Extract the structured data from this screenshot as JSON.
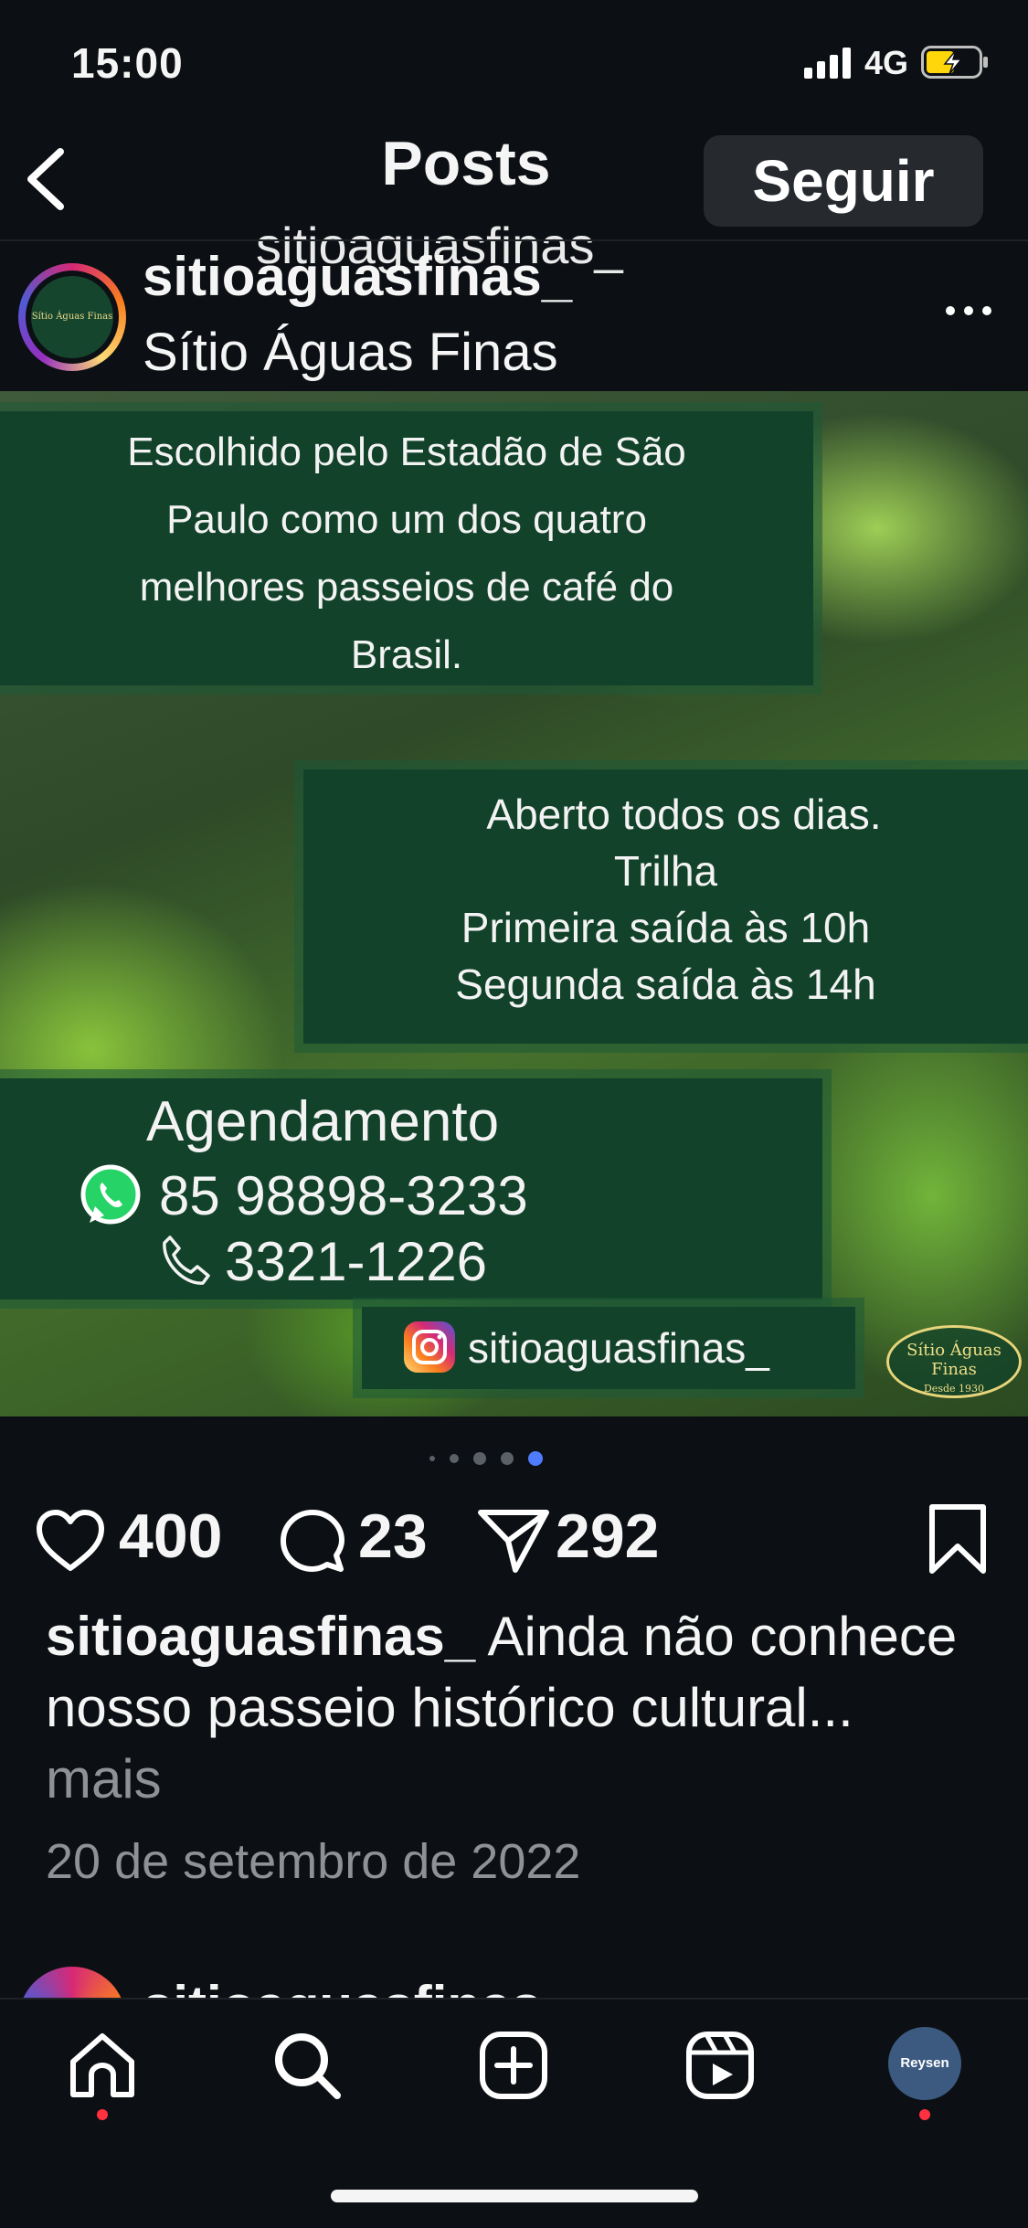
{
  "status_bar": {
    "time": "15:00",
    "network": "4G"
  },
  "header": {
    "title": "Posts",
    "subtitle": "sitioaguasfinas_",
    "follow_label": "Seguir"
  },
  "post": {
    "username": "sitioaguasfinas_",
    "location": "Sítio Águas Finas",
    "image": {
      "box1": [
        "Escolhido pelo Estadão de São",
        "Paulo como um dos quatro",
        "melhores passeios de café do",
        "Brasil."
      ],
      "box2": [
        "Aberto todos os dias.",
        "Trilha",
        "Primeira saída às 10h",
        "Segunda saída às 14h"
      ],
      "agenda_title": "Agendamento",
      "whatsapp": "85 98898-3233",
      "phone": "3321-1226",
      "instagram": "sitioaguasfinas_",
      "logo_name": "Sítio Águas Finas",
      "logo_since": "Desde 1930"
    },
    "carousel": {
      "count": 5,
      "active": 5
    },
    "likes": "400",
    "comments": "23",
    "shares": "292",
    "caption_user": "sitioaguasfinas_",
    "caption_text": " Ainda não conhece nosso passeio histórico cultural...",
    "caption_more": " mais",
    "date": "20 de setembro de 2022"
  },
  "next_post": {
    "username": "sitioaguasfinas_"
  },
  "tabbar": {
    "profile_label": "Reysen"
  },
  "colors": {
    "background": "#0c1014",
    "box": "#12422a",
    "accent_dot": "#4f7cff",
    "notification": "#ff3040"
  }
}
